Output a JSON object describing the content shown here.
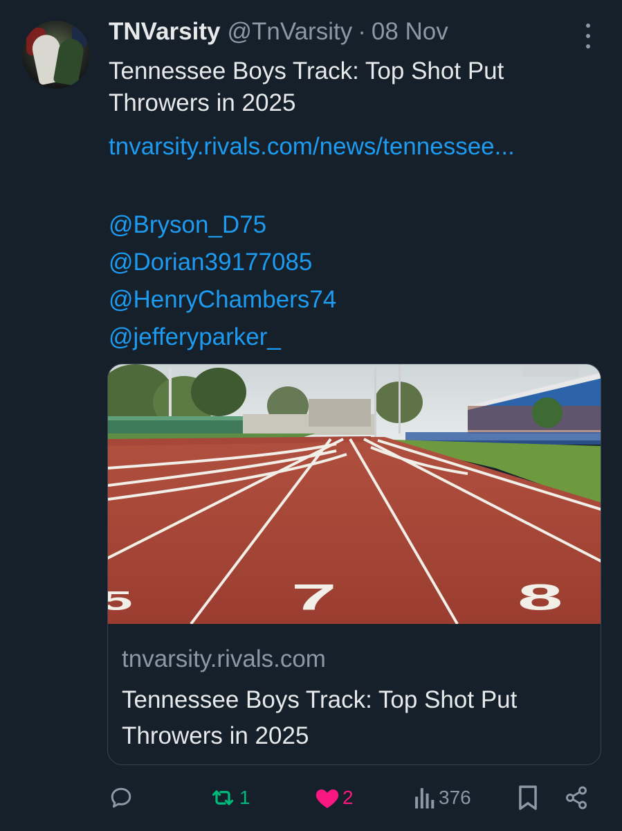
{
  "author": {
    "name": "TNVarsity",
    "handle": "@TnVarsity",
    "separator": "·",
    "time": "08 Nov"
  },
  "tweet": {
    "text": "Tennessee Boys Track: Top Shot Put Throwers in 2025",
    "link": "tnvarsity.rivals.com/news/tennessee...",
    "mentions": [
      "@Bryson_D75",
      "@Dorian39177085",
      "@HenryChambers74",
      "@jefferyparker_"
    ]
  },
  "card": {
    "image_icon": "track-lanes-photo",
    "lane_numbers": [
      "5",
      "7",
      "8"
    ],
    "domain": "tnvarsity.rivals.com",
    "title": "Tennessee Boys Track: Top Shot Put Throwers in 2025"
  },
  "actions": {
    "reply": {
      "icon": "reply-icon",
      "count": ""
    },
    "retweet": {
      "icon": "retweet-icon",
      "count": "1",
      "color": "#00ba7c"
    },
    "like": {
      "icon": "heart-icon",
      "count": "2",
      "color": "#f91880"
    },
    "views": {
      "icon": "views-icon",
      "count": "376"
    },
    "bookmark": {
      "icon": "bookmark-icon"
    },
    "share": {
      "icon": "share-icon"
    }
  },
  "colors": {
    "background": "#15202b",
    "text": "#e7e9ea",
    "muted": "#8b98a5",
    "link": "#1d9bf0",
    "border": "#38444d"
  }
}
